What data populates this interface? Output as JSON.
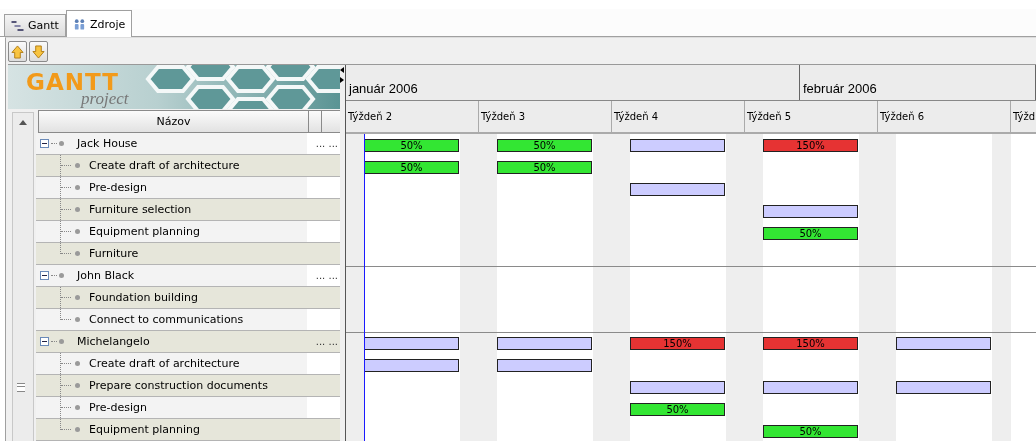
{
  "tabs": [
    {
      "label": "Gantt",
      "selected": false
    },
    {
      "label": "Zdroje",
      "selected": true
    }
  ],
  "toolbar": [
    {
      "kind": "up"
    },
    {
      "kind": "down"
    }
  ],
  "logo": {
    "title": "GANTT",
    "subtitle": "project"
  },
  "table": {
    "columns": [
      {
        "label": "Názov"
      }
    ]
  },
  "resources": [
    {
      "name": "Jack House",
      "expanded": true,
      "extra": "... ...",
      "loads": [
        {
          "kind": "normal",
          "label": "50%"
        },
        {
          "kind": "normal",
          "label": "50%"
        },
        {
          "kind": "under"
        },
        {
          "kind": "over",
          "label": "150%"
        },
        {
          "kind": "none"
        }
      ],
      "tasks": [
        {
          "name": "Create draft of architecture",
          "loads": [
            {
              "kind": "normal",
              "label": "50%"
            },
            {
              "kind": "normal",
              "label": "50%"
            },
            {
              "kind": "none"
            },
            {
              "kind": "none"
            },
            {
              "kind": "none"
            }
          ]
        },
        {
          "name": "Pre-design",
          "loads": [
            {
              "kind": "none"
            },
            {
              "kind": "none"
            },
            {
              "kind": "under"
            },
            {
              "kind": "none"
            },
            {
              "kind": "none"
            }
          ]
        },
        {
          "name": "Furniture selection",
          "loads": [
            {
              "kind": "none"
            },
            {
              "kind": "none"
            },
            {
              "kind": "none"
            },
            {
              "kind": "under"
            },
            {
              "kind": "none"
            }
          ]
        },
        {
          "name": "Equipment planning",
          "loads": [
            {
              "kind": "none"
            },
            {
              "kind": "none"
            },
            {
              "kind": "none"
            },
            {
              "kind": "normal",
              "label": "50%"
            },
            {
              "kind": "none"
            }
          ]
        },
        {
          "name": "Furniture",
          "loads": [
            {
              "kind": "none"
            },
            {
              "kind": "none"
            },
            {
              "kind": "none"
            },
            {
              "kind": "none"
            },
            {
              "kind": "none"
            }
          ]
        }
      ]
    },
    {
      "name": "John Black",
      "expanded": true,
      "extra": "... ...",
      "loads": [
        {
          "kind": "none"
        },
        {
          "kind": "none"
        },
        {
          "kind": "none"
        },
        {
          "kind": "none"
        },
        {
          "kind": "none"
        }
      ],
      "tasks": [
        {
          "name": "Foundation building",
          "loads": [
            {
              "kind": "none"
            },
            {
              "kind": "none"
            },
            {
              "kind": "none"
            },
            {
              "kind": "none"
            },
            {
              "kind": "none"
            }
          ]
        },
        {
          "name": "Connect to communications",
          "loads": [
            {
              "kind": "none"
            },
            {
              "kind": "none"
            },
            {
              "kind": "none"
            },
            {
              "kind": "none"
            },
            {
              "kind": "none"
            }
          ]
        }
      ]
    },
    {
      "name": "Michelangelo",
      "expanded": true,
      "extra": "... ...",
      "loads": [
        {
          "kind": "under"
        },
        {
          "kind": "under"
        },
        {
          "kind": "over",
          "label": "150%"
        },
        {
          "kind": "over",
          "label": "150%"
        },
        {
          "kind": "under"
        }
      ],
      "tasks": [
        {
          "name": "Create draft of architecture",
          "loads": [
            {
              "kind": "under"
            },
            {
              "kind": "under"
            },
            {
              "kind": "none"
            },
            {
              "kind": "none"
            },
            {
              "kind": "none"
            }
          ]
        },
        {
          "name": "Prepare construction documents",
          "loads": [
            {
              "kind": "none"
            },
            {
              "kind": "none"
            },
            {
              "kind": "under"
            },
            {
              "kind": "under"
            },
            {
              "kind": "under"
            }
          ]
        },
        {
          "name": "Pre-design",
          "loads": [
            {
              "kind": "none"
            },
            {
              "kind": "none"
            },
            {
              "kind": "normal",
              "label": "50%"
            },
            {
              "kind": "none"
            },
            {
              "kind": "none"
            }
          ]
        },
        {
          "name": "Equipment planning",
          "loads": [
            {
              "kind": "none"
            },
            {
              "kind": "none"
            },
            {
              "kind": "none"
            },
            {
              "kind": "normal",
              "label": "50%"
            },
            {
              "kind": "none"
            }
          ]
        }
      ]
    }
  ],
  "timeline": {
    "months": [
      {
        "label": "január 2006"
      },
      {
        "label": "február 2006"
      }
    ],
    "weeks": [
      "Týždeň 2",
      "Týždeň 3",
      "Týždeň 4",
      "Týždeň 5",
      "Týždeň 6",
      "Týžd"
    ]
  }
}
